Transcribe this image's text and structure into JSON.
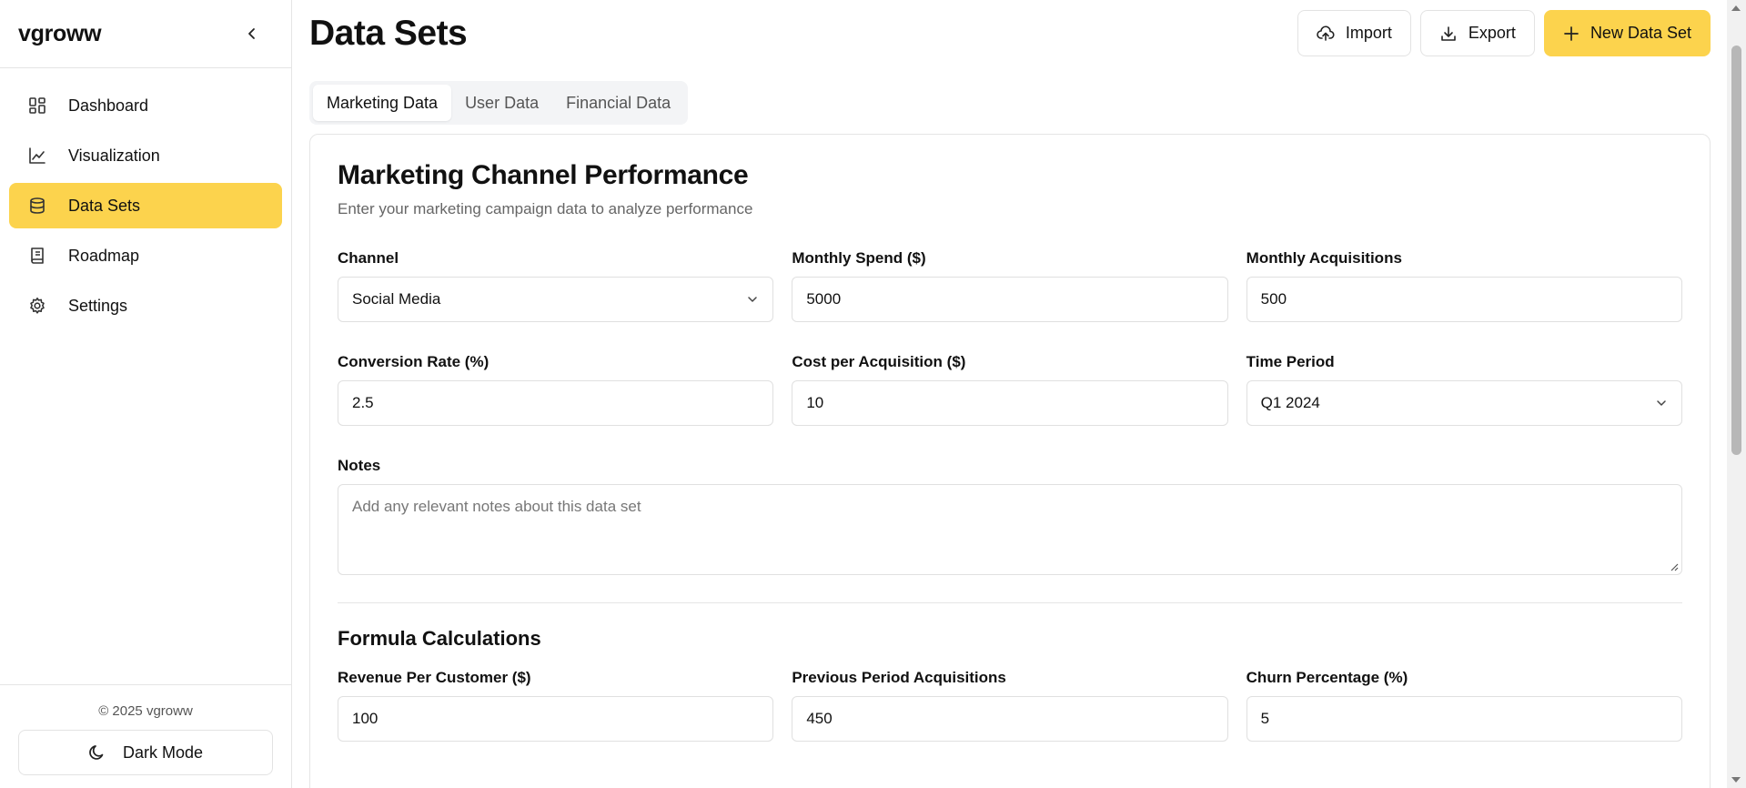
{
  "sidebar": {
    "brand": "vgroww",
    "items": [
      {
        "label": "Dashboard",
        "icon": "dashboard-icon"
      },
      {
        "label": "Visualization",
        "icon": "chart-line-icon"
      },
      {
        "label": "Data Sets",
        "icon": "database-icon"
      },
      {
        "label": "Roadmap",
        "icon": "book-icon"
      },
      {
        "label": "Settings",
        "icon": "gear-icon"
      }
    ],
    "active_item": "Data Sets",
    "copyright": "© 2025 vgroww",
    "dark_mode_label": "Dark Mode"
  },
  "header": {
    "title": "Data Sets",
    "import_label": "Import",
    "export_label": "Export",
    "new_label": "New Data Set"
  },
  "tabs": [
    {
      "label": "Marketing Data"
    },
    {
      "label": "User Data"
    },
    {
      "label": "Financial Data"
    }
  ],
  "card": {
    "title": "Marketing Channel Performance",
    "subtitle": "Enter your marketing campaign data to analyze performance",
    "fields": {
      "channel": {
        "label": "Channel",
        "value": "Social Media"
      },
      "monthly_spend": {
        "label": "Monthly Spend ($)",
        "value": "5000"
      },
      "monthly_acquisitions": {
        "label": "Monthly Acquisitions",
        "value": "500"
      },
      "conversion_rate": {
        "label": "Conversion Rate (%)",
        "value": "2.5"
      },
      "cpa": {
        "label": "Cost per Acquisition ($)",
        "value": "10"
      },
      "time_period": {
        "label": "Time Period",
        "value": "Q1 2024"
      },
      "notes": {
        "label": "Notes",
        "placeholder": "Add any relevant notes about this data set"
      }
    },
    "formula": {
      "title": "Formula Calculations",
      "revenue_per_customer": {
        "label": "Revenue Per Customer ($)",
        "value": "100"
      },
      "previous_acquisitions": {
        "label": "Previous Period Acquisitions",
        "value": "450"
      },
      "churn": {
        "label": "Churn Percentage (%)",
        "value": "5"
      }
    }
  },
  "colors": {
    "accent": "#fcd34d",
    "border": "#e5e5e5"
  }
}
